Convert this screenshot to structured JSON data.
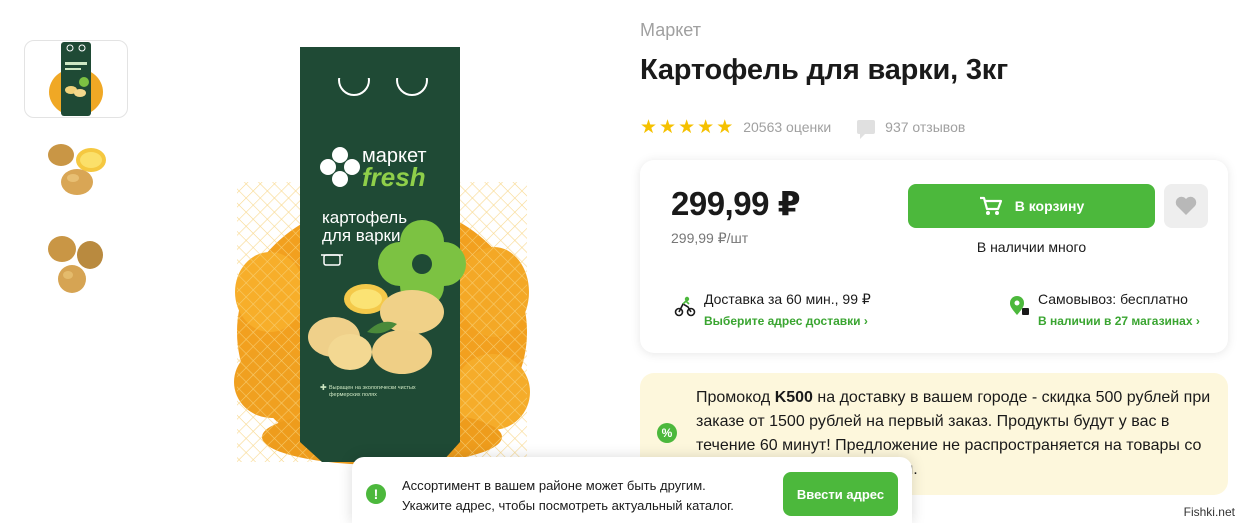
{
  "breadcrumb": "Маркет",
  "product": {
    "title": "Картофель для варки, 3кг",
    "rating_stars": 5,
    "ratings_count": "20563 оценки",
    "reviews_count": "937 отзывов"
  },
  "buy_card": {
    "price": "299,99 ₽",
    "unit_price": "299,99 ₽/шт",
    "cart_label": "В корзину",
    "stock": "В наличии много",
    "delivery": {
      "title": "Доставка за 60 мин., 99 ₽",
      "link": "Выберите адрес доставки"
    },
    "pickup": {
      "title": "Самовывоз: бесплатно",
      "link": "В наличии в 27 магазинах"
    }
  },
  "promo": {
    "icon": "%",
    "text_before_code": "Промокод ",
    "code": "K500",
    "text_after_code": " на доставку в вашем городе - скидка 500 рублей при заказе от 1500 рублей на первый заказ. Продукты будут у вас в течение 60 минут! Предложение не распространяется на товары со",
    "text_tail": "ены."
  },
  "package": {
    "brand_top": "маркет",
    "brand_bottom": "fresh",
    "product_line1": "картофель",
    "product_line2": "для варки",
    "footnote_line1": "Выращен на экологически чистых",
    "footnote_line2": "фермерских полях"
  },
  "toast": {
    "icon": "!",
    "line1": "Ассортимент в вашем районе может быть другим.",
    "line2": "Укажите адрес, чтобы посмотреть актуальный каталог.",
    "button": "Ввести адрес"
  },
  "watermark": "Fishki.net",
  "colors": {
    "accent_green": "#4cb83c",
    "link_green": "#3aa531",
    "star_yellow": "#f5c100",
    "package_green": "#1f4a35",
    "promo_bg": "#fdf7dc"
  }
}
